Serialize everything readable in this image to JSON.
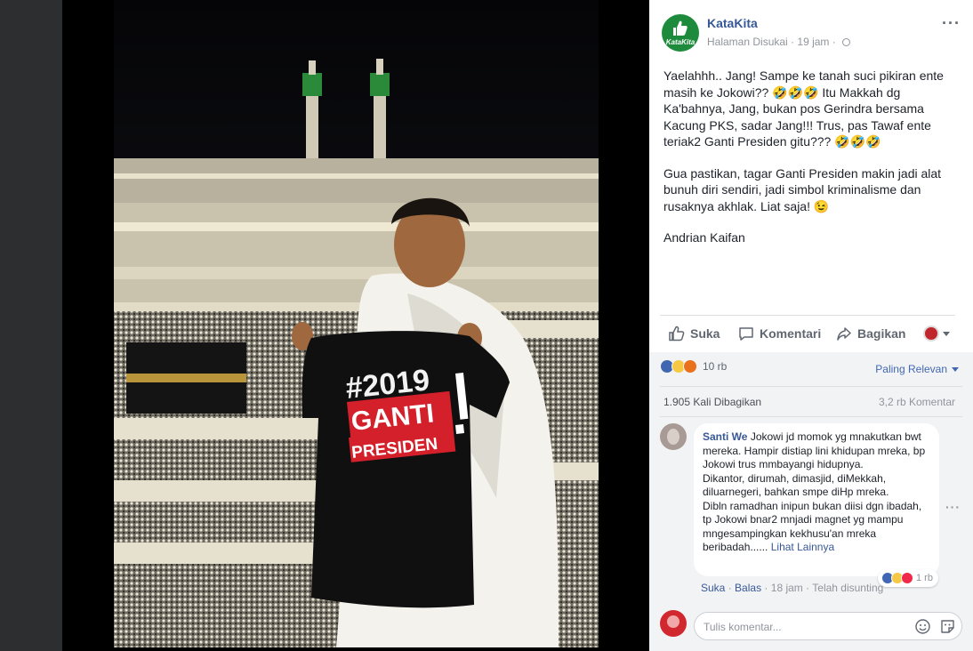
{
  "post": {
    "page_name": "KataKita",
    "page_avatar_text": "KataKita",
    "status": "Halaman Disukai",
    "time": "19 jam",
    "paragraphs": [
      "Yaelahhh.. Jang! Sampe ke tanah suci pikiran ente masih ke Jokowi?? 🤣🤣🤣 Itu Makkah dg Ka'bahnya, Jang, bukan pos Gerindra bersama Kacung PKS, sadar Jang!!! Trus, pas Tawaf ente teriak2 Ganti Presiden gitu??? 🤣🤣🤣",
      "Gua pastikan, tagar Ganti Presiden makin jadi alat bunuh diri sendiri, jadi simbol kriminalisme dan rusaknya akhlak. Liat saja! 😉",
      "Andrian Kaifan"
    ],
    "photo_shirt_text": {
      "line1": "#2019",
      "line2": "GANTI",
      "line3": "PRESIDEN"
    }
  },
  "actions": {
    "like": "Suka",
    "comment": "Komentari",
    "share": "Bagikan"
  },
  "stats": {
    "reactions_count": "10 rb",
    "sort_label": "Paling Relevan",
    "shares": "1.905 Kali Dibagikan",
    "comments": "3,2 rb Komentar"
  },
  "comment": {
    "author": "Santi We",
    "text": "Jokowi jd momok yg mnakutkan bwt mereka. Hampir distiap lini khidupan mreka, bp Jokowi trus mmbayangi hidupnya.\nDikantor, dirumah, dimasjid, diMekkah, diluarnegeri, bahkan smpe diHp mreka.\nDibln ramadhan inipun bukan diisi dgn ibadah, tp Jokowi bnar2 mnjadi magnet yg mampu mngesampingkan kekhusu'an mreka beribadah......",
    "see_more": "Lihat Lainnya",
    "reaction_count": "1 rb",
    "like": "Suka",
    "reply": "Balas",
    "time": "18 jam",
    "edited": "Telah disunting"
  },
  "compose": {
    "placeholder": "Tulis komentar..."
  },
  "colors": {
    "link": "#365899",
    "meta": "#90949c",
    "page_bg": "#3a3b3c",
    "shirt_red": "#d4202a"
  },
  "icons": [
    "thumbs-up-icon",
    "comment-icon",
    "share-icon",
    "globe-icon",
    "emoji-icon",
    "sticker-icon",
    "more-icon"
  ]
}
